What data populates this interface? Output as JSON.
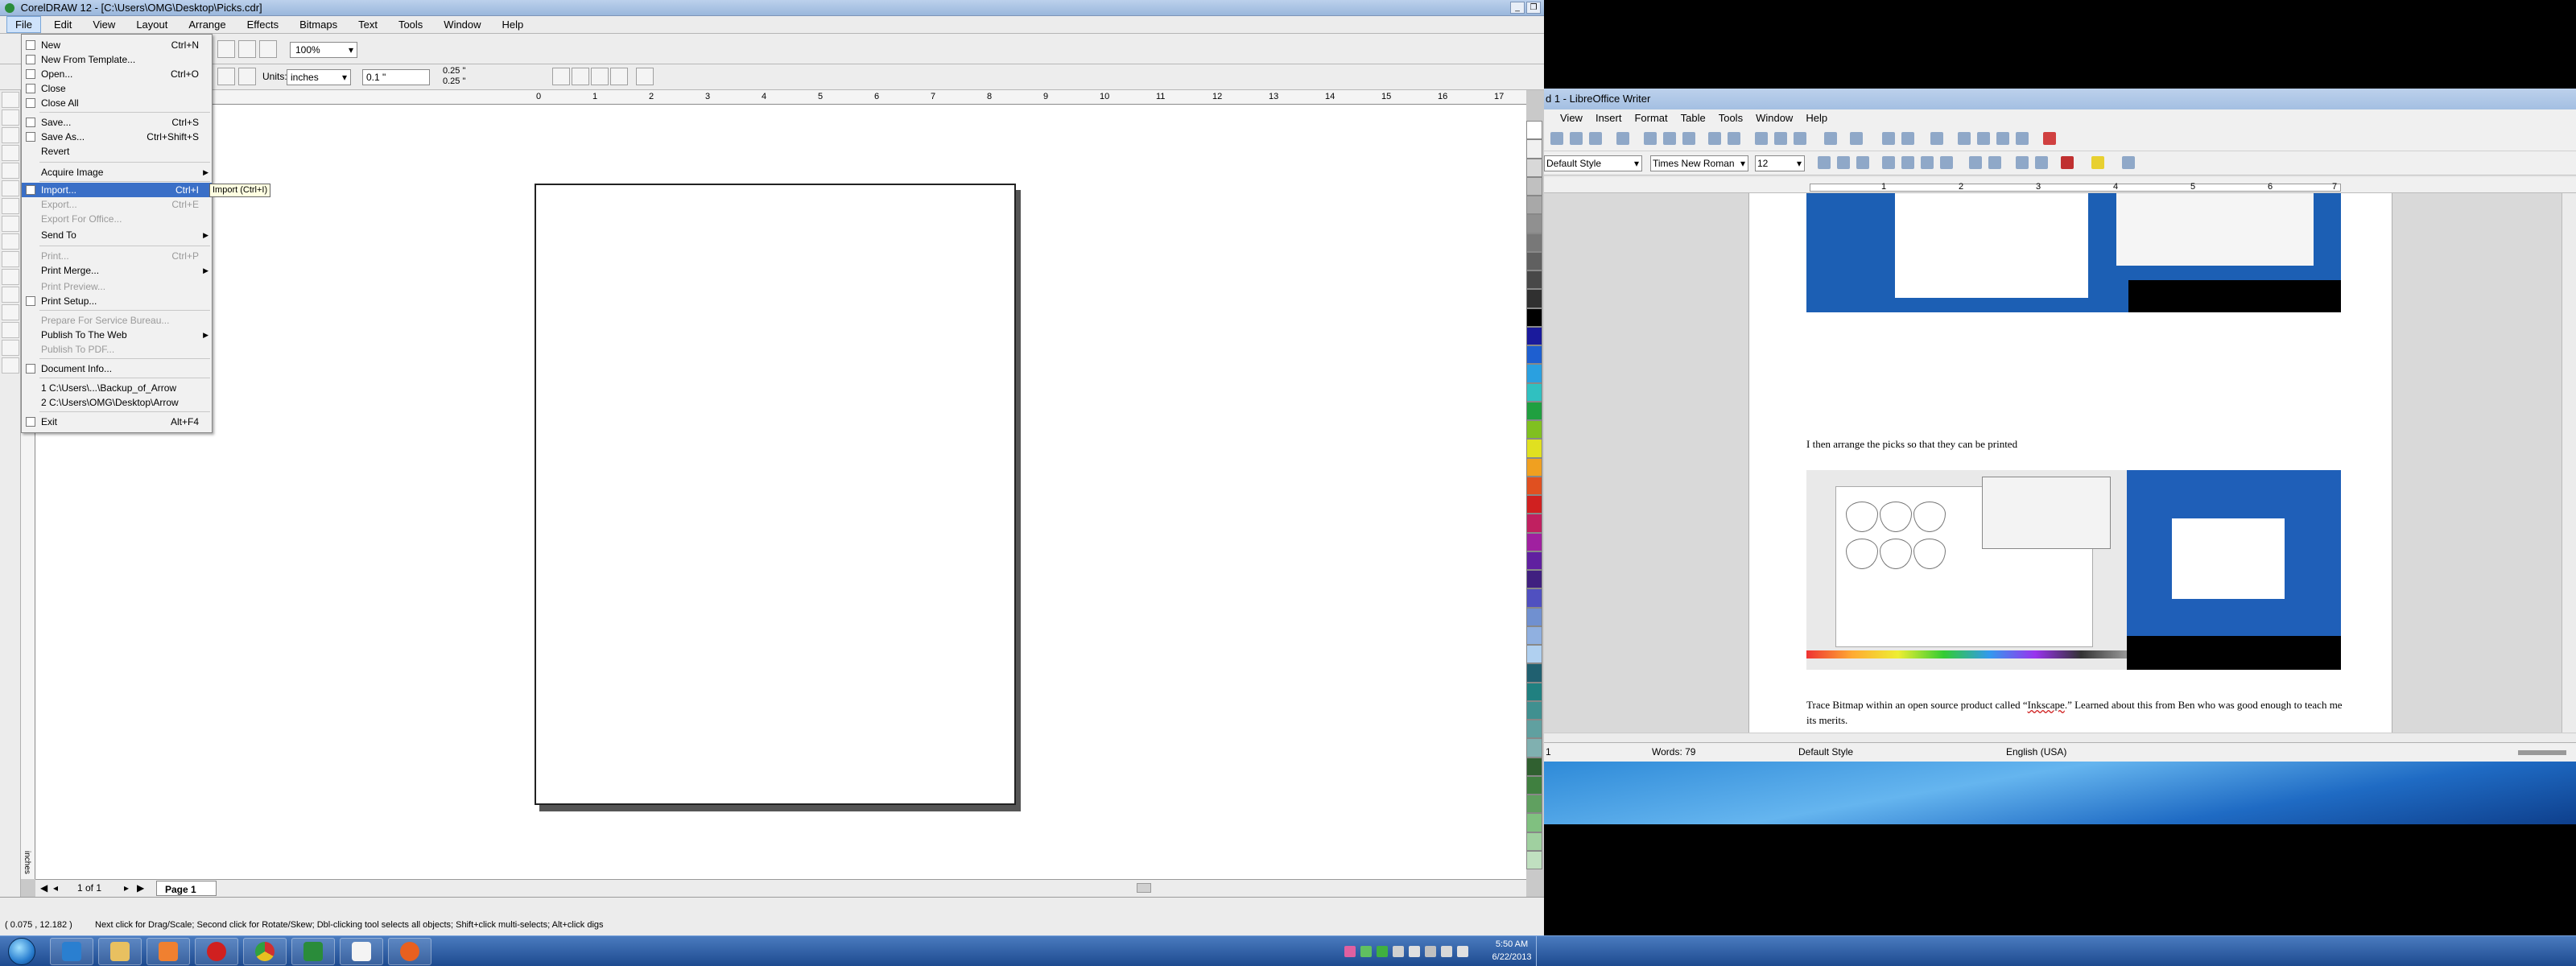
{
  "coreldraw": {
    "title": "CorelDRAW 12 - [C:\\Users\\OMG\\Desktop\\Picks.cdr]",
    "menu": [
      "File",
      "Edit",
      "View",
      "Layout",
      "Arrange",
      "Effects",
      "Bitmaps",
      "Text",
      "Tools",
      "Window",
      "Help"
    ],
    "zoom": "100%",
    "units_label": "Units:",
    "units_value": "inches",
    "nudge": "0.1 \"",
    "duplicate_x": "0.25 \"",
    "duplicate_y": "0.25 \"",
    "ruler_numbers": [
      "0",
      "1",
      "2",
      "3",
      "4",
      "5",
      "6",
      "7",
      "8",
      "9",
      "10",
      "11",
      "12",
      "13",
      "14",
      "15",
      "16",
      "17"
    ],
    "ruler_unit": "inches",
    "file_menu": {
      "items": [
        {
          "label": "New",
          "shortcut": "Ctrl+N"
        },
        {
          "label": "New From Template...",
          "shortcut": ""
        },
        {
          "label": "Open...",
          "shortcut": "Ctrl+O"
        },
        {
          "label": "Close",
          "shortcut": ""
        },
        {
          "label": "Close All",
          "shortcut": ""
        },
        {
          "label": "Save...",
          "shortcut": "Ctrl+S"
        },
        {
          "label": "Save As...",
          "shortcut": "Ctrl+Shift+S"
        },
        {
          "label": "Revert",
          "shortcut": ""
        },
        {
          "label": "Acquire Image",
          "shortcut": ""
        },
        {
          "label": "Import...",
          "shortcut": "Ctrl+I"
        },
        {
          "label": "Export...",
          "shortcut": "Ctrl+E"
        },
        {
          "label": "Export For Office...",
          "shortcut": ""
        },
        {
          "label": "Send To",
          "shortcut": ""
        },
        {
          "label": "Print...",
          "shortcut": "Ctrl+P"
        },
        {
          "label": "Print Merge...",
          "shortcut": ""
        },
        {
          "label": "Print Preview...",
          "shortcut": ""
        },
        {
          "label": "Print Setup...",
          "shortcut": ""
        },
        {
          "label": "Prepare For Service Bureau...",
          "shortcut": ""
        },
        {
          "label": "Publish To The Web",
          "shortcut": ""
        },
        {
          "label": "Publish To PDF...",
          "shortcut": ""
        },
        {
          "label": "Document Info...",
          "shortcut": ""
        },
        {
          "label": "1 C:\\Users\\...\\Backup_of_Arrow",
          "shortcut": ""
        },
        {
          "label": "2 C:\\Users\\OMG\\Desktop\\Arrow",
          "shortcut": ""
        },
        {
          "label": "Exit",
          "shortcut": "Alt+F4"
        }
      ]
    },
    "tooltip": "Import (Ctrl+I)",
    "page_count": "1 of 1",
    "page_tab": "Page 1",
    "status_coords": "( 0.075 , 12.182 )",
    "status_hint": "Next click for Drag/Scale; Second click for Rotate/Skew; Dbl-clicking tool selects all objects; Shift+click multi-selects; Alt+click digs"
  },
  "writer": {
    "title": "d 1 - LibreOffice Writer",
    "menu": [
      "View",
      "Insert",
      "Format",
      "Table",
      "Tools",
      "Window",
      "Help"
    ],
    "style": "Default Style",
    "font": "Times New Roman",
    "size": "12",
    "ruler_numbers": [
      "1",
      "2",
      "3",
      "4",
      "5",
      "6",
      "7"
    ],
    "para1": "I then arrange the picks so that they can be printed",
    "para2_a": "Trace Bitmap within an open source product called “",
    "para2_link": "Inkscape",
    "para2_b": ".”   Learned about this from Ben who was good enough to teach me its merits.",
    "status_page": "1",
    "status_words": "Words: 79",
    "status_style": "Default Style",
    "status_lang": "English (USA)"
  },
  "taskbar": {
    "time": "5:50 AM",
    "date": "6/22/2013"
  },
  "palette_colors": [
    "#ffffff",
    "#f0f0f0",
    "#d8d8d8",
    "#c0c0c0",
    "#a8a8a8",
    "#909090",
    "#787878",
    "#606060",
    "#484848",
    "#303030",
    "#000000",
    "#1a1a9c",
    "#1e5fd0",
    "#2aa0e0",
    "#30c0c0",
    "#20a040",
    "#80c020",
    "#e0e020",
    "#f0a020",
    "#e05020",
    "#d02020",
    "#c02060",
    "#a020a0",
    "#6020a0",
    "#402080",
    "#5050c0",
    "#7090d0",
    "#90b0e0",
    "#b0d0f0",
    "#206070",
    "#208080",
    "#409090",
    "#60a0a0",
    "#80b0b0",
    "#306030",
    "#408040",
    "#60a060",
    "#80c080",
    "#a0d0a0",
    "#c0e0c0"
  ]
}
